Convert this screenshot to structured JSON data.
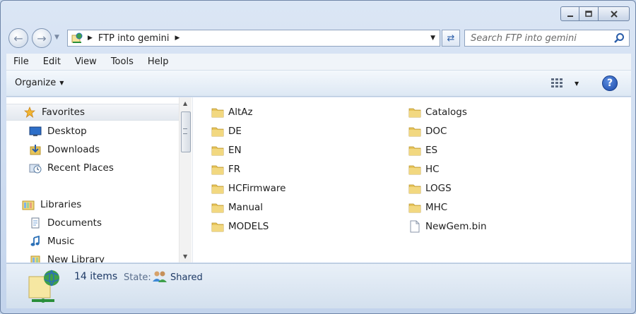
{
  "nav": {
    "address": [
      "FTP into gemini"
    ],
    "search_placeholder": "Search FTP into gemini"
  },
  "menu": [
    "File",
    "Edit",
    "View",
    "Tools",
    "Help"
  ],
  "toolbar": {
    "organize": "Organize"
  },
  "sidebar": {
    "items": [
      {
        "label": "Favorites",
        "icon": "star-icon"
      },
      {
        "label": "Desktop",
        "icon": "desktop-icon"
      },
      {
        "label": "Downloads",
        "icon": "downloads-icon"
      },
      {
        "label": "Recent Places",
        "icon": "recent-places-icon"
      },
      {
        "label": "Libraries",
        "icon": "libraries-icon"
      },
      {
        "label": "Documents",
        "icon": "documents-icon"
      },
      {
        "label": "Music",
        "icon": "music-icon"
      },
      {
        "label": "New Library",
        "icon": "library-icon"
      }
    ]
  },
  "files": [
    {
      "name": "AltAz",
      "type": "folder"
    },
    {
      "name": "Catalogs",
      "type": "folder"
    },
    {
      "name": "DE",
      "type": "folder"
    },
    {
      "name": "DOC",
      "type": "folder"
    },
    {
      "name": "EN",
      "type": "folder"
    },
    {
      "name": "ES",
      "type": "folder"
    },
    {
      "name": "FR",
      "type": "folder"
    },
    {
      "name": "HC",
      "type": "folder"
    },
    {
      "name": "HCFirmware",
      "type": "folder"
    },
    {
      "name": "LOGS",
      "type": "folder"
    },
    {
      "name": "Manual",
      "type": "folder"
    },
    {
      "name": "MHC",
      "type": "folder"
    },
    {
      "name": "MODELS",
      "type": "folder"
    },
    {
      "name": "NewGem.bin",
      "type": "file"
    }
  ],
  "details": {
    "count": "14 items",
    "state_label": "State:",
    "state_value": "Shared"
  },
  "colors": {
    "folder": "#e7c45a",
    "accent": "#2a5da8"
  }
}
